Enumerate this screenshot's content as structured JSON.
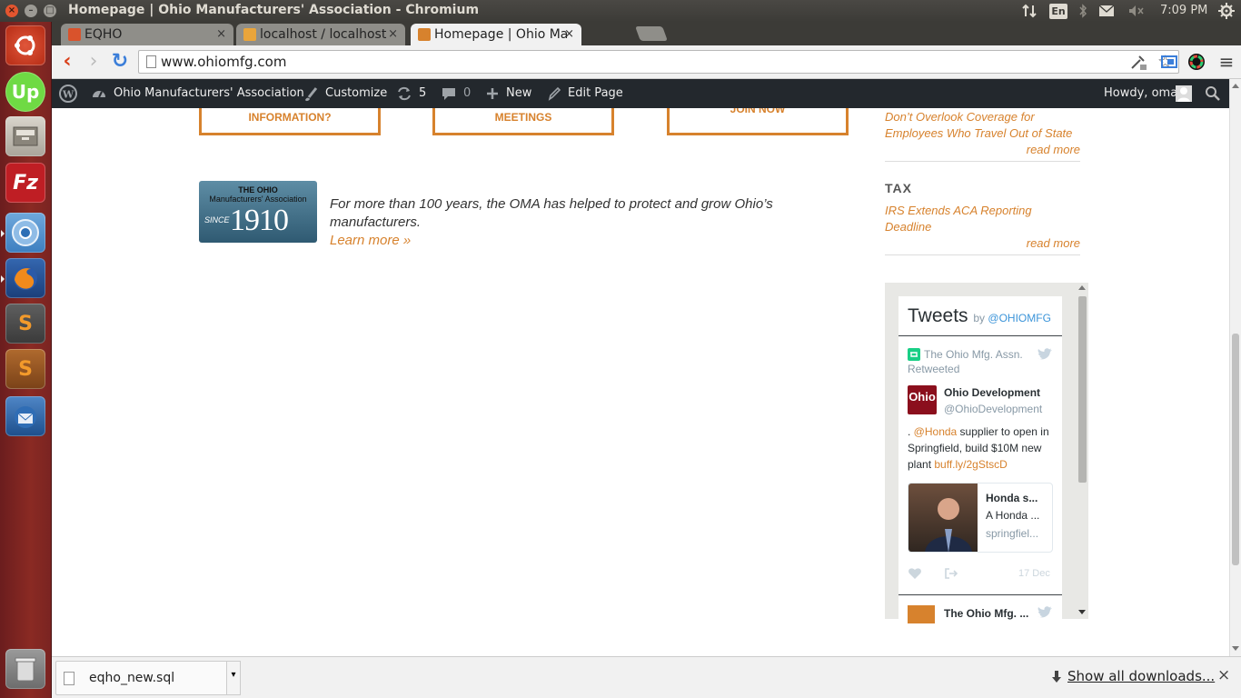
{
  "window": {
    "title": "Homepage | Ohio Manufacturers' Association - Chromium",
    "close_glyph": "×",
    "min_glyph": "–",
    "max_glyph": "□"
  },
  "tray": {
    "lang": "En",
    "time": "7:09 PM",
    "icons": [
      "network-arrows-icon",
      "bluetooth-icon",
      "mail-icon",
      "volume-muted-icon",
      "power-gear-icon"
    ]
  },
  "launcher": {
    "apps": [
      "ubuntu-dash-icon",
      "upwork-icon",
      "files-icon",
      "filezilla-icon",
      "chromium-icon",
      "firefox-icon",
      "sublime-text-icon",
      "sublime-text-2-icon",
      "thunderbird-icon",
      "trash-icon"
    ],
    "upwork_label": "Up",
    "filezilla_label": "Fz"
  },
  "tabs": [
    {
      "label": "EQHO",
      "active": false,
      "favicon_color": "#d9532c"
    },
    {
      "label": "localhost / localhost",
      "active": false,
      "favicon_color": "#e9a53b"
    },
    {
      "label": "Homepage | Ohio Ma",
      "active": true,
      "favicon_color": "#d7822d"
    }
  ],
  "tab_close_glyph": "×",
  "toolbar": {
    "url": "www.ohiomfg.com",
    "back_glyph": "‹",
    "forward_glyph": "›",
    "reload_glyph": "↻",
    "star_glyph": "☆",
    "menu_glyph": "≡"
  },
  "adminbar": {
    "site_name": "Ohio Manufacturers' Association",
    "customize": "Customize",
    "updates_count": "5",
    "comments_count": "0",
    "new": "New",
    "edit_page": "Edit Page",
    "howdy": "Howdy, oma"
  },
  "content": {
    "cta_buttons": [
      "INFORMATION?",
      "MEETINGS",
      "JOIN NOW"
    ],
    "logo": {
      "line1": "THE OHIO",
      "line2": "Manufacturers' Association",
      "since": "SINCE",
      "year": "1910"
    },
    "intro_text": "For more than 100 years, the OMA has helped to protect and grow Ohio’s manufacturers.",
    "learn_more": "Learn more »"
  },
  "sidebar": {
    "post1": {
      "title": "Don’t Overlook Coverage for Employees Who Travel Out of State",
      "read_more": "read more"
    },
    "tax_heading": "TAX",
    "post2": {
      "title": "IRS Extends ACA Reporting Deadline",
      "read_more": "read more"
    }
  },
  "twitter": {
    "title": "Tweets",
    "by": "by",
    "handle": "@OHIOMFG",
    "retweet_line1": "The Ohio Mfg. Assn.",
    "retweet_line2": "Retweeted",
    "author_name": "Ohio Development",
    "author_handle": "@OhioDevelopment",
    "avatar_text": "Ohio",
    "tweet_prefix": ". ",
    "tweet_mention": "@Honda",
    "tweet_body": " supplier to open in Springfield, build $10M new plant ",
    "tweet_link": "buff.ly/2gStscD",
    "card_title": "Honda s...",
    "card_desc": "A Honda ...",
    "card_domain": "springfiel...",
    "date": "17 Dec",
    "next_author": "The Ohio Mfg. ..."
  },
  "downloads": {
    "file_name": "eqho_new.sql",
    "show_all": "Show all downloads...",
    "close_glyph": "×"
  }
}
